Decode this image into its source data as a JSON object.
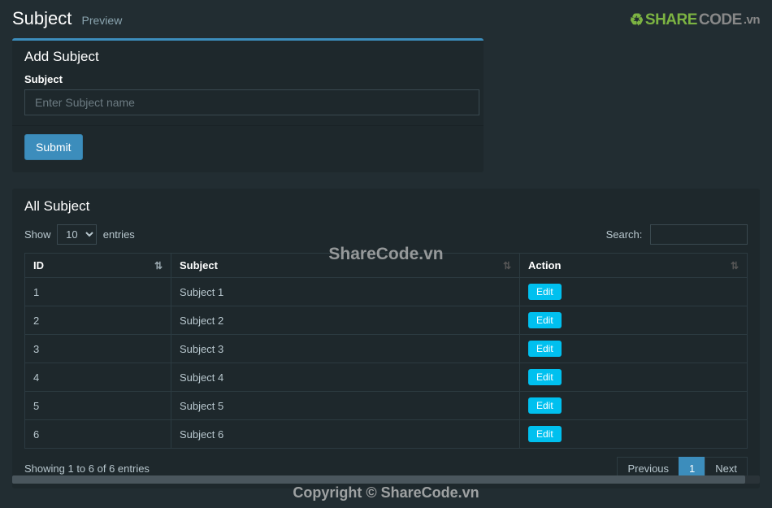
{
  "header": {
    "title": "Subject",
    "subtitle": "Preview",
    "logo": {
      "share": "SHARE",
      "code": "CODE",
      "vn": ".vn"
    }
  },
  "addForm": {
    "panelTitle": "Add Subject",
    "label": "Subject",
    "placeholder": "Enter Subject name",
    "submitLabel": "Submit"
  },
  "listPanel": {
    "title": "All Subject",
    "lengthPrefix": "Show",
    "lengthSuffix": "entries",
    "lengthSelected": "10",
    "searchLabel": "Search:",
    "columns": {
      "id": "ID",
      "subject": "Subject",
      "action": "Action"
    },
    "rows": [
      {
        "id": "1",
        "subject": "Subject 1",
        "action": "Edit"
      },
      {
        "id": "2",
        "subject": "Subject 2",
        "action": "Edit"
      },
      {
        "id": "3",
        "subject": "Subject 3",
        "action": "Edit"
      },
      {
        "id": "4",
        "subject": "Subject 4",
        "action": "Edit"
      },
      {
        "id": "5",
        "subject": "Subject 5",
        "action": "Edit"
      },
      {
        "id": "6",
        "subject": "Subject 6",
        "action": "Edit"
      }
    ],
    "info": "Showing 1 to 6 of 6 entries",
    "pagination": {
      "prev": "Previous",
      "current": "1",
      "next": "Next"
    }
  },
  "watermark": {
    "center": "ShareCode.vn",
    "bottom": "Copyright © ShareCode.vn"
  }
}
